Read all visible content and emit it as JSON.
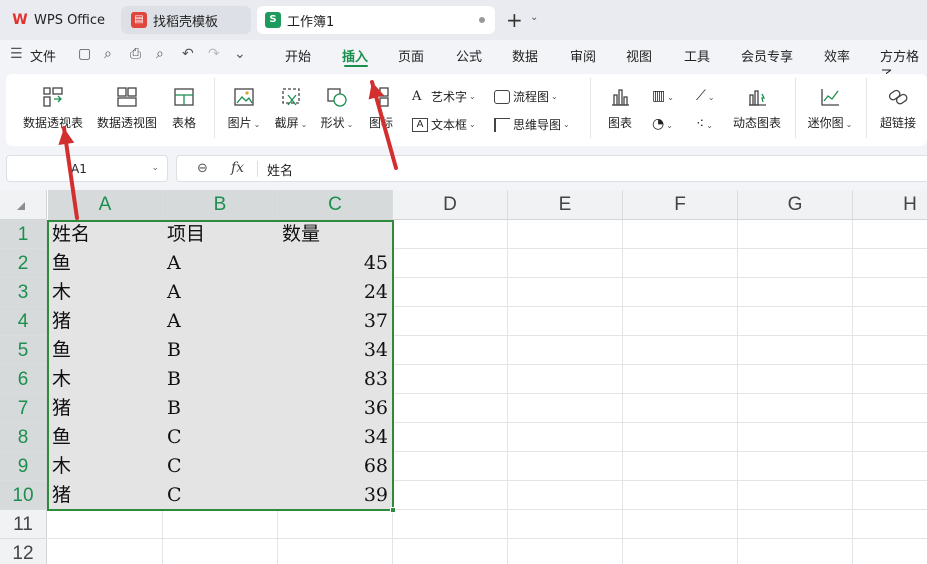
{
  "titlebar": {
    "tabs": [
      {
        "label": "WPS Office",
        "icon": "wps-logo-icon"
      },
      {
        "label": "找稻壳模板",
        "icon": "docer-icon"
      },
      {
        "label": "工作簿1",
        "icon": "spreadsheet-icon",
        "icon_text": "S",
        "active": true
      }
    ],
    "new_tab": "+",
    "new_tab_caret": "⌄"
  },
  "menubar": {
    "file_label": "文件",
    "hamburger": "☰",
    "quick_icons": [
      "▢",
      "⌕",
      "⎙",
      "⌕",
      "↶",
      "↷",
      "⌄"
    ],
    "items": [
      "开始",
      "插入",
      "页面",
      "公式",
      "数据",
      "审阅",
      "视图",
      "工具",
      "会员专享",
      "效率",
      "方方格子"
    ],
    "active": "插入"
  },
  "ribbon": {
    "pivot_table": "数据透视表",
    "pivot_chart": "数据透视图",
    "table": "表格",
    "picture": "图片",
    "screenshot": "截屏",
    "shape": "形状",
    "icon": "图标",
    "word_art": "艺术字",
    "text_box": "文本框",
    "flowchart": "流程图",
    "mind_map": "思维导图",
    "chart": "图表",
    "dynamic_chart": "动态图表",
    "sparkline": "迷你图",
    "hyperlink": "超链接",
    "caret": "⌄"
  },
  "formula_bar": {
    "name_box": "A1",
    "name_caret": "⌄",
    "zoom_icon": "⊖",
    "fx": "fx",
    "value": "姓名"
  },
  "sheet": {
    "columns": [
      "A",
      "B",
      "C",
      "D",
      "E",
      "F",
      "G",
      "H"
    ],
    "rows": [
      "1",
      "2",
      "3",
      "4",
      "5",
      "6",
      "7",
      "8",
      "9",
      "10",
      "11",
      "12"
    ],
    "data": [
      [
        "姓名",
        "项目",
        "数量"
      ],
      [
        "鱼",
        "A",
        "45"
      ],
      [
        "木",
        "A",
        "24"
      ],
      [
        "猪",
        "A",
        "37"
      ],
      [
        "鱼",
        "B",
        "34"
      ],
      [
        "木",
        "B",
        "83"
      ],
      [
        "猪",
        "B",
        "36"
      ],
      [
        "鱼",
        "C",
        "34"
      ],
      [
        "木",
        "C",
        "68"
      ],
      [
        "猪",
        "C",
        "39"
      ]
    ],
    "selection": "A1:C10"
  },
  "colors": {
    "accent": "#1b8f4e",
    "selection_border": "#2e8b3c",
    "annotation_arrow": "#d32f2f"
  }
}
